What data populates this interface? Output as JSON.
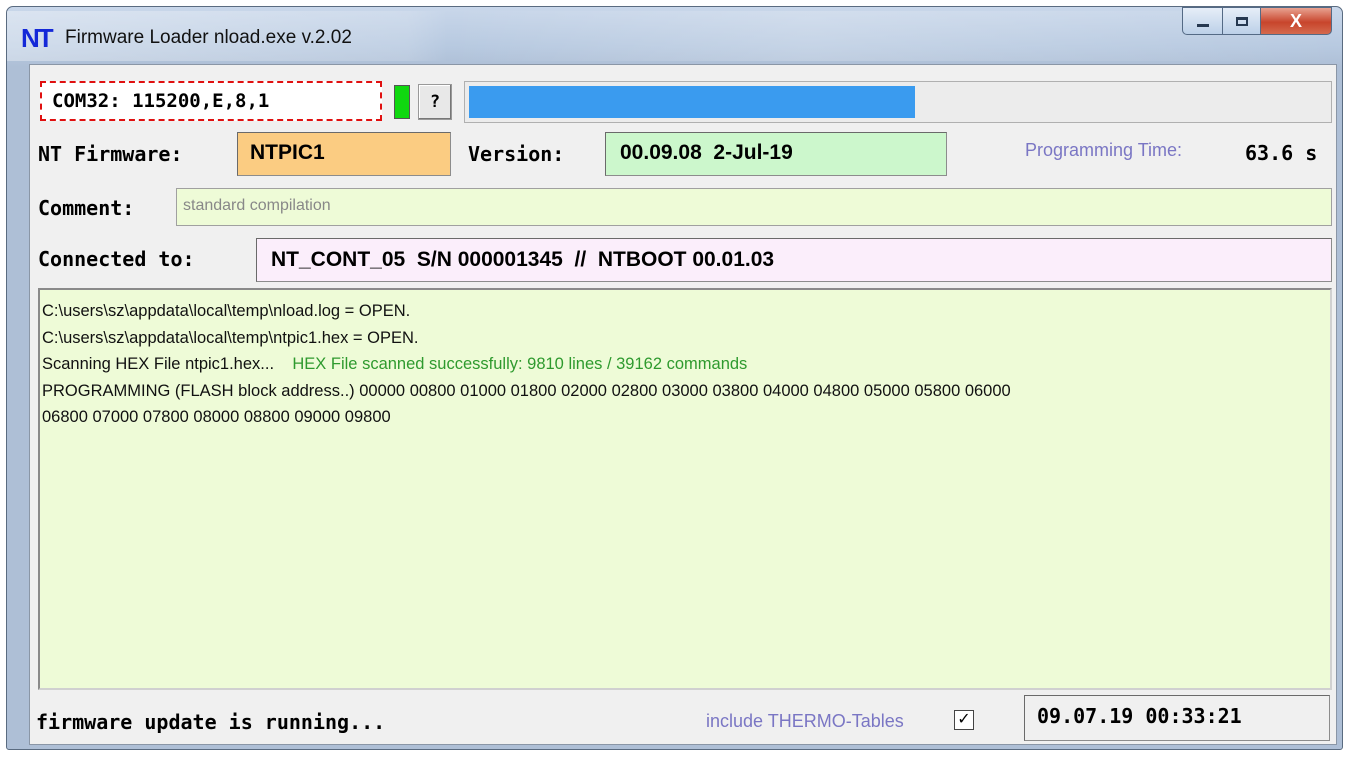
{
  "window": {
    "logo": "NT",
    "title": "Firmware Loader  nload.exe  v.2.02",
    "close_glyph": "X",
    "icons": [
      "minimize-icon",
      "maximize-icon",
      "close-icon"
    ]
  },
  "port": {
    "settings": "COM32: 115200,E,8,1",
    "led_color": "#10d810",
    "help_label": "?"
  },
  "progress": {
    "fraction": 0.52,
    "color": "#3a9bef"
  },
  "firmware": {
    "label": "NT Firmware:",
    "value": "NTPIC1",
    "version_label": "Version:",
    "version_value": "00.09.08  2-Jul-19",
    "prog_time_label": "Programming Time:",
    "prog_time_value": "63.6 s"
  },
  "comment": {
    "label": "Comment:",
    "value": "standard compilation"
  },
  "connection": {
    "label": "Connected to:",
    "value": "NT_CONT_05  S/N 000001345  //  NTBOOT 00.01.03"
  },
  "log": {
    "lines": [
      {
        "text": "C:\\users\\sz\\appdata\\local\\temp\\nload.log = OPEN."
      },
      {
        "text": "C:\\users\\sz\\appdata\\local\\temp\\ntpic1.hex = OPEN."
      },
      {
        "text": "Scanning HEX File ntpic1.hex...",
        "extra": "HEX File scanned successfully: 9810 lines / 39162 commands"
      },
      {
        "text": "PROGRAMMING (FLASH block address..) 00000 00800 01000 01800 02000 02800 03000 03800 04000 04800 05000 05800 06000"
      },
      {
        "text": "06800 07000 07800 08000 08800 09000 09800"
      }
    ]
  },
  "footer": {
    "status": "firmware update is running...",
    "thermo_label": "include THERMO-Tables",
    "thermo_checked": "✓",
    "datetime": "09.07.19  00:33:21"
  }
}
